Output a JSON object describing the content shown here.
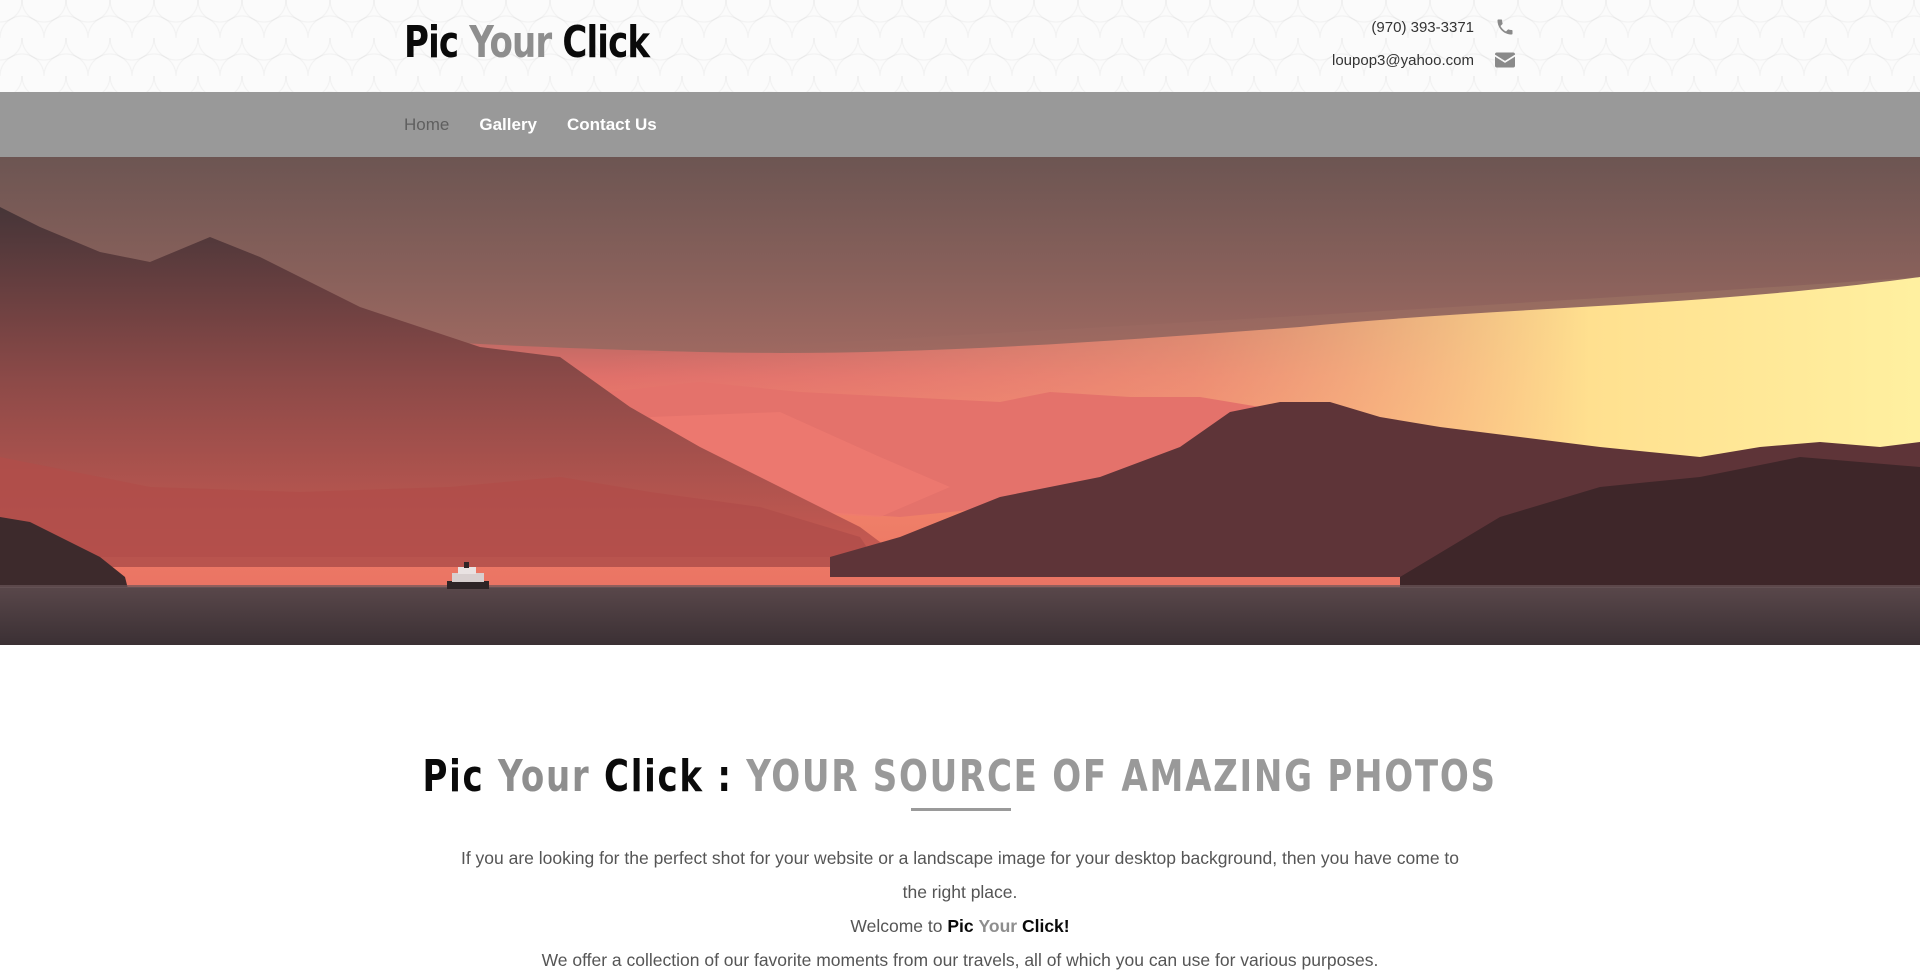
{
  "header": {
    "logo": {
      "word1": "Pic",
      "word2": "Your",
      "word3": "Click"
    },
    "phone": "(970) 393-3371",
    "email": "loupop3@yahoo.com",
    "icons": {
      "phone": "phone-icon",
      "email": "envelope-icon"
    }
  },
  "nav": {
    "items": [
      {
        "label": "Home"
      },
      {
        "label": "Gallery"
      },
      {
        "label": "Contact Us"
      }
    ]
  },
  "hero": {
    "subject": "sunset over mountains and water with a ship"
  },
  "intro": {
    "title_word1": "Pic",
    "title_word2": "Your",
    "title_word3": "Click",
    "title_sep": ":",
    "title_tagline": "YOUR SOURCE OF AMAZING PHOTOS",
    "para1": "If you are looking for the perfect shot for your website or a landscape image for your desktop background, then you have come to the right place.",
    "welcome_prefix": "Welcome to",
    "welcome_word1": "Pic",
    "welcome_word2": "Your",
    "welcome_word3": "Click!",
    "para3": "We offer a collection of our favorite moments from our travels, all of which you can use for various purposes."
  },
  "colors": {
    "nav_bg": "#999999",
    "accent_gray": "#8e8e8e",
    "text": "#555555",
    "black": "#0a0a0a"
  }
}
